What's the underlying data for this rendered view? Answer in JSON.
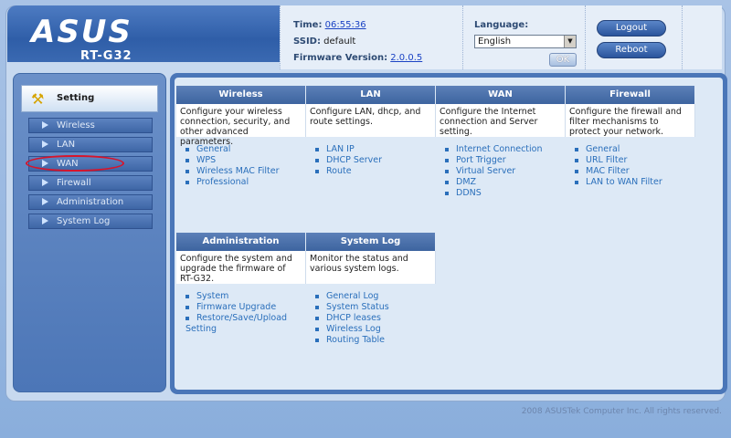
{
  "header": {
    "brand": "ASUS",
    "model": "RT-G32",
    "time_label": "Time:",
    "time_value": "06:55:36",
    "ssid_label": "SSID:",
    "ssid_value": "default",
    "fw_label": "Firmware Version:",
    "fw_value": "2.0.0.5",
    "language_label": "Language:",
    "language_selected": "English",
    "ok_label": "OK",
    "logout_label": "Logout",
    "reboot_label": "Reboot"
  },
  "sidebar": {
    "title": "Setting",
    "items": [
      {
        "label": "Wireless"
      },
      {
        "label": "LAN"
      },
      {
        "label": "WAN"
      },
      {
        "label": "Firewall"
      },
      {
        "label": "Administration"
      },
      {
        "label": "System Log"
      }
    ]
  },
  "cards": [
    {
      "title": "Wireless",
      "desc": "Configure your wireless connection, security, and other advanced parameters.",
      "links": [
        "General",
        "WPS",
        "Wireless MAC Filter",
        "Professional"
      ]
    },
    {
      "title": "LAN",
      "desc": "Configure LAN, dhcp, and route settings.",
      "links": [
        "LAN IP",
        "DHCP Server",
        "Route"
      ]
    },
    {
      "title": "WAN",
      "desc": "Configure the Internet connection and Server setting.",
      "links": [
        "Internet Connection",
        "Port Trigger",
        "Virtual Server",
        "DMZ",
        "DDNS"
      ]
    },
    {
      "title": "Firewall",
      "desc": "Configure the firewall and filter mechanisms to protect your network.",
      "links": [
        "General",
        "URL Filter",
        "MAC Filter",
        "LAN to WAN Filter"
      ]
    },
    {
      "title": "Administration",
      "desc": "Configure the system and upgrade the firmware of RT-G32.",
      "links": [
        "System",
        "Firmware Upgrade",
        "Restore/Save/Upload Setting"
      ]
    },
    {
      "title": "System Log",
      "desc": "Monitor the status and various system logs.",
      "links": [
        "General Log",
        "System Status",
        "DHCP leases",
        "Wireless Log",
        "Routing Table"
      ]
    }
  ],
  "footer": "2008 ASUSTek Computer Inc. All rights reserved."
}
